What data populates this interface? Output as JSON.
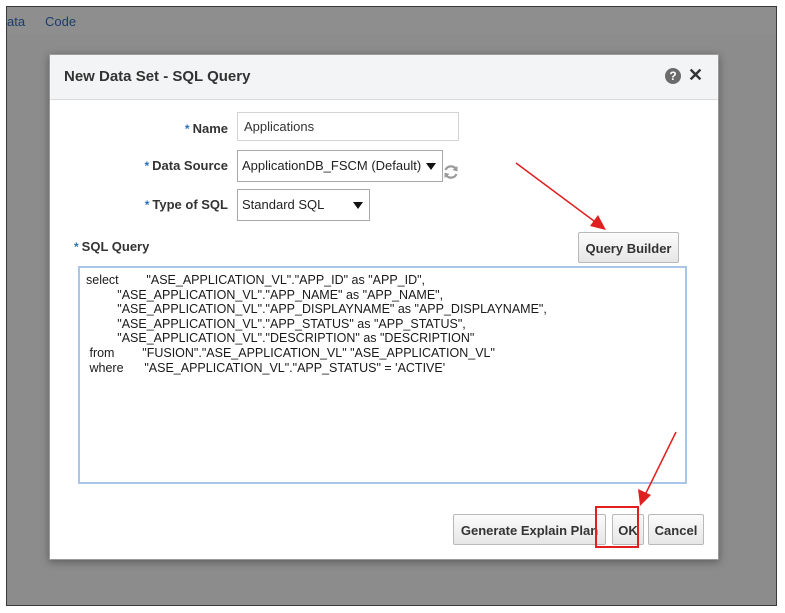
{
  "menu": {
    "item1": "ata",
    "item2": "Code"
  },
  "dialog": {
    "title": "New Data Set - SQL Query",
    "help_icon": "?",
    "close_icon": "✕",
    "required_marker": "*",
    "name_label": "Name",
    "name_value": "Applications",
    "datasource_label": "Data Source",
    "datasource_value": "ApplicationDB_FSCM (Default)",
    "sqltype_label": "Type of SQL",
    "sqltype_value": "Standard SQL",
    "sqlquery_label": "SQL Query",
    "query_builder_button": "Query Builder",
    "sql_lines": [
      "select        \"ASE_APPLICATION_VL\".\"APP_ID\" as \"APP_ID\",",
      "         \"ASE_APPLICATION_VL\".\"APP_NAME\" as \"APP_NAME\",",
      "         \"ASE_APPLICATION_VL\".\"APP_DISPLAYNAME\" as \"APP_DISPLAYNAME\",",
      "         \"ASE_APPLICATION_VL\".\"APP_STATUS\" as \"APP_STATUS\",",
      "         \"ASE_APPLICATION_VL\".\"DESCRIPTION\" as \"DESCRIPTION\"",
      " from        \"FUSION\".\"ASE_APPLICATION_VL\" \"ASE_APPLICATION_VL\"",
      " where      \"ASE_APPLICATION_VL\".\"APP_STATUS\" = 'ACTIVE'"
    ],
    "generate_button": "Generate Explain Plan",
    "ok_button": "OK",
    "cancel_button": "Cancel"
  },
  "icons": {
    "help": "help-icon",
    "close": "close-icon",
    "refresh": "refresh-icon",
    "dropdown": "caret-down-icon"
  },
  "colors": {
    "annotation": "#e02020",
    "required": "#2d72b8",
    "focus_border": "#a9c6e8"
  }
}
